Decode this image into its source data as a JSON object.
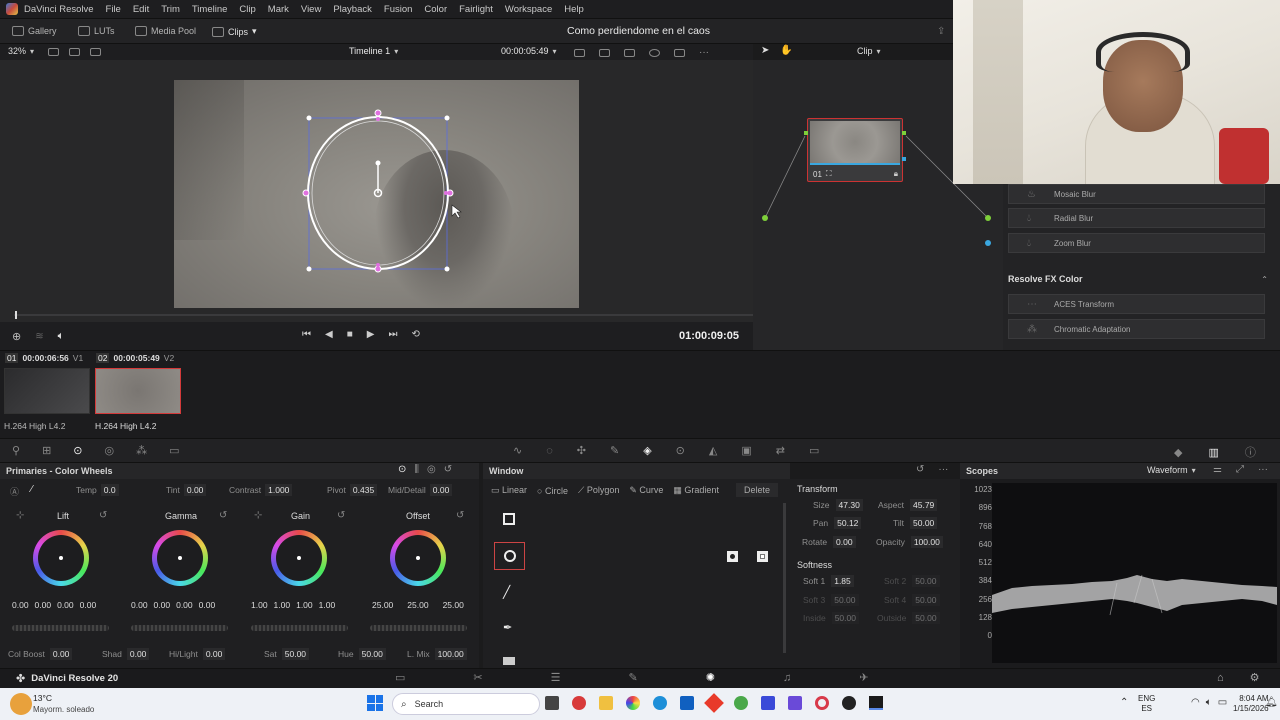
{
  "app": {
    "logo_label": "DaVinci Resolve",
    "menu": [
      "File",
      "Edit",
      "Trim",
      "Timeline",
      "Clip",
      "Mark",
      "View",
      "Playback",
      "Fusion",
      "Color",
      "Fairlight",
      "Workspace",
      "Help"
    ],
    "project_title": "Como perdiendome en el caos"
  },
  "toolbar": {
    "gallery": "Gallery",
    "luts": "LUTs",
    "media_pool": "Media Pool",
    "clips": "Clips"
  },
  "viewer": {
    "zoom": "32%",
    "timeline_name": "Timeline 1",
    "source_timecode": "00:00:05:49",
    "clip_mode": "Clip",
    "record_timecode": "01:00:09:05"
  },
  "node": {
    "label": "01"
  },
  "fx": {
    "items_blur": [
      "Mosaic Blur",
      "Radial Blur",
      "Zoom Blur"
    ],
    "section_color": "Resolve FX Color",
    "items_color": [
      "ACES Transform",
      "Chromatic Adaptation"
    ]
  },
  "clips": [
    {
      "index": "01",
      "timecode": "00:00:06:56",
      "track": "V1",
      "codec": "H.264 High L4.2"
    },
    {
      "index": "02",
      "timecode": "00:00:05:49",
      "track": "V2",
      "codec": "H.264 High L4.2"
    }
  ],
  "primaries": {
    "title": "Primaries - Color Wheels",
    "temp_label": "Temp",
    "temp": "0.0",
    "tint_label": "Tint",
    "tint": "0.00",
    "contrast_label": "Contrast",
    "contrast": "1.000",
    "pivot_label": "Pivot",
    "pivot": "0.435",
    "middetail_label": "Mid/Detail",
    "middetail": "0.00",
    "wheels": [
      {
        "name": "Lift",
        "values": [
          "0.00",
          "0.00",
          "0.00",
          "0.00"
        ]
      },
      {
        "name": "Gamma",
        "values": [
          "0.00",
          "0.00",
          "0.00",
          "0.00"
        ]
      },
      {
        "name": "Gain",
        "values": [
          "1.00",
          "1.00",
          "1.00",
          "1.00"
        ]
      },
      {
        "name": "Offset",
        "values": [
          "25.00",
          "25.00",
          "25.00"
        ]
      }
    ],
    "colboost_label": "Col Boost",
    "colboost": "0.00",
    "shad_label": "Shad",
    "shad": "0.00",
    "hilight_label": "Hi/Light",
    "hilight": "0.00",
    "sat_label": "Sat",
    "sat": "50.00",
    "hue_label": "Hue",
    "hue": "50.00",
    "lmix_label": "L. Mix",
    "lmix": "100.00"
  },
  "window": {
    "title": "Window",
    "linear": "Linear",
    "circle": "Circle",
    "polygon": "Polygon",
    "curve": "Curve",
    "gradient": "Gradient",
    "delete": "Delete"
  },
  "transform": {
    "title": "Transform",
    "size_label": "Size",
    "size": "47.30",
    "aspect_label": "Aspect",
    "aspect": "45.79",
    "pan_label": "Pan",
    "pan": "50.12",
    "tilt_label": "Tilt",
    "tilt": "50.00",
    "rotate_label": "Rotate",
    "rotate": "0.00",
    "opacity_label": "Opacity",
    "opacity": "100.00",
    "softness_title": "Softness",
    "soft1_label": "Soft 1",
    "soft1": "1.85",
    "soft2_label": "Soft 2",
    "soft2": "50.00",
    "soft3_label": "Soft 3",
    "soft3": "50.00",
    "soft4_label": "Soft 4",
    "soft4": "50.00",
    "inside_label": "Inside",
    "inside": "50.00",
    "outside_label": "Outside",
    "outside": "50.00"
  },
  "scopes": {
    "title": "Scopes",
    "mode": "Waveform",
    "ticks": [
      "1023",
      "896",
      "768",
      "640",
      "512",
      "384",
      "256",
      "128",
      "0"
    ]
  },
  "footer": {
    "app_name": "DaVinci Resolve 20"
  },
  "taskbar": {
    "weather_temp": "13°C",
    "weather_desc": "Mayorm. soleado",
    "search": "Search",
    "lang1": "ENG",
    "lang2": "ES",
    "time": "8:04 AM",
    "date": "1/15/2026"
  }
}
